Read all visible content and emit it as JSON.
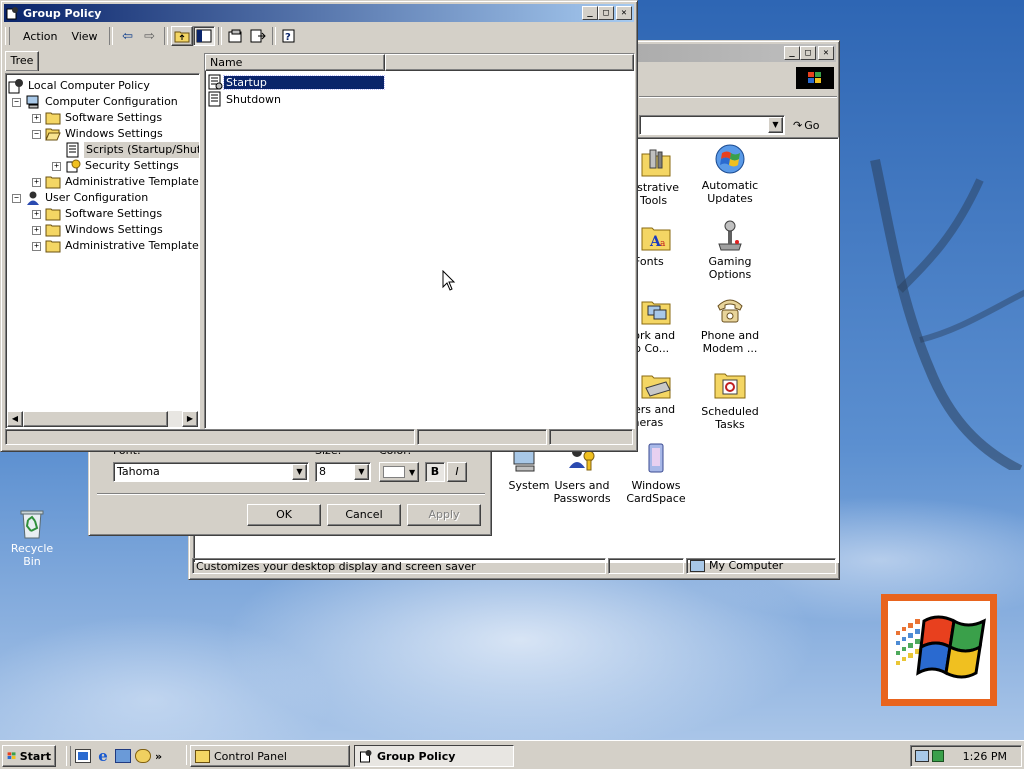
{
  "desktop": {
    "recycle_bin_label": "Recycle Bin"
  },
  "control_panel": {
    "address_go": "Go",
    "icons": [
      {
        "label1": "inistrative",
        "label2": "Tools",
        "icon": "admin-tools-icon"
      },
      {
        "label1": "Automatic",
        "label2": "Updates",
        "icon": "windows-update-icon"
      },
      {
        "label1": "Fonts",
        "label2": "",
        "icon": "fonts-folder-icon"
      },
      {
        "label1": "Gaming",
        "label2": "Options",
        "icon": "joystick-icon"
      },
      {
        "label1": "twork and",
        "label2": "l-up Co...",
        "icon": "network-icon"
      },
      {
        "label1": "Phone and",
        "label2": "Modem ...",
        "icon": "phone-icon"
      },
      {
        "label1": "nners and",
        "label2": "ameras",
        "icon": "scanner-icon"
      },
      {
        "label1": "Scheduled",
        "label2": "Tasks",
        "icon": "scheduled-tasks-icon"
      },
      {
        "label1": "System",
        "label2": "",
        "icon": "system-icon"
      },
      {
        "label1": "Users and",
        "label2": "Passwords",
        "icon": "users-icon"
      },
      {
        "label1": "Windows",
        "label2": "CardSpace",
        "icon": "cardspace-icon"
      }
    ],
    "status_text": "Customizes your desktop display and screen saver",
    "status_zone": "My Computer"
  },
  "display_dialog": {
    "font_label": "Font:",
    "size_label": "Size:",
    "color_label": "Color:",
    "font_value": "Tahoma",
    "size_value": "8",
    "bold_label": "B",
    "italic_label": "I",
    "ok_label": "OK",
    "cancel_label": "Cancel",
    "apply_label": "Apply"
  },
  "group_policy": {
    "title": "Group Policy",
    "menu": {
      "action": "Action",
      "view": "View"
    },
    "tree_tab": "Tree",
    "name_header": "Name",
    "tree": [
      {
        "label": "Local Computer Policy",
        "level": 0,
        "exp": "",
        "icon": "policy"
      },
      {
        "label": "Computer Configuration",
        "level": 1,
        "exp": "−",
        "icon": "computer"
      },
      {
        "label": "Software Settings",
        "level": 2,
        "exp": "+",
        "icon": "folder"
      },
      {
        "label": "Windows Settings",
        "level": 2,
        "exp": "−",
        "icon": "folder-open"
      },
      {
        "label": "Scripts (Startup/Shutdo",
        "level": 3,
        "exp": "",
        "icon": "script",
        "selected": true
      },
      {
        "label": "Security Settings",
        "level": 3,
        "exp": "+",
        "icon": "security"
      },
      {
        "label": "Administrative Templates",
        "level": 2,
        "exp": "+",
        "icon": "folder"
      },
      {
        "label": "User Configuration",
        "level": 1,
        "exp": "−",
        "icon": "user"
      },
      {
        "label": "Software Settings",
        "level": 2,
        "exp": "+",
        "icon": "folder"
      },
      {
        "label": "Windows Settings",
        "level": 2,
        "exp": "+",
        "icon": "folder"
      },
      {
        "label": "Administrative Templates",
        "level": 2,
        "exp": "+",
        "icon": "folder"
      }
    ],
    "items": [
      {
        "label": "Startup",
        "selected": true
      },
      {
        "label": "Shutdown",
        "selected": false
      }
    ]
  },
  "taskbar": {
    "start_label": "Start",
    "tasks": [
      {
        "label": "Control Panel",
        "active": false
      },
      {
        "label": "Group Policy",
        "active": true
      }
    ],
    "clock": "1:26 PM"
  },
  "colors": {
    "title_active": "#0a246a",
    "title_inactive": "#808080",
    "selection": "#0a246a",
    "face": "#d4d0c8",
    "desktop": "#3b6ea5"
  }
}
